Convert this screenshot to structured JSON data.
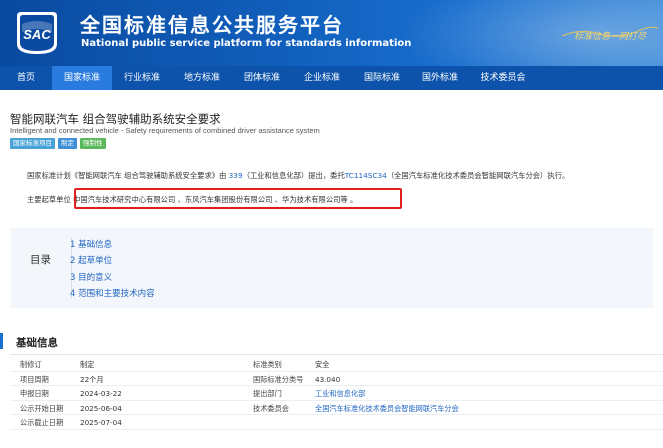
{
  "header": {
    "logo_text": "SAC",
    "title": "全国标准信息公共服务平台",
    "subtitle": "National public service platform  for standards information",
    "slogan": "标准信息一网打尽"
  },
  "nav": {
    "items": [
      {
        "label": "首页",
        "width": 52
      },
      {
        "label": "国家标准",
        "width": 60,
        "active": true
      },
      {
        "label": "行业标准",
        "width": 60
      },
      {
        "label": "地方标准",
        "width": 60
      },
      {
        "label": "团体标准",
        "width": 60
      },
      {
        "label": "企业标准",
        "width": 60
      },
      {
        "label": "国际标准",
        "width": 60
      },
      {
        "label": "国外标准",
        "width": 56
      },
      {
        "label": "技术委员会",
        "width": 70
      }
    ]
  },
  "standard": {
    "title_cn": "智能网联汽车 组合驾驶辅助系统安全要求",
    "title_en": "Intelligent and connected vehicle - Safety requirements of combined driver assistance system",
    "tags": [
      "国家标准项目",
      "制定",
      "强制性"
    ]
  },
  "description": {
    "part1": "国家标准计划《智能网联汽车 组合驾驶辅助系统安全要求》由 ",
    "dept_code": "339",
    "part2": "（工业和信息化部）提出，委托",
    "tc_code": "TC114SC34",
    "part3": "（全国汽车标准化技术委员会智能网联汽车分会）执行。",
    "drafters_label": "主要起草单位",
    "drafters": " 中国汽车技术研究中心有限公司 、东风汽车集团股份有限公司 、华为技术有限公司等 。"
  },
  "toc": {
    "label": "目录",
    "items": [
      "1  基础信息",
      "2  起草单位",
      "3  目的意义",
      "4  范围和主要技术内容"
    ]
  },
  "basic_info": {
    "section_title": "基础信息",
    "rows": [
      {
        "l1": "制修订",
        "v1": "制定",
        "l2": "标准类别",
        "v2": "安全",
        "v2_link": false
      },
      {
        "l1": "项目周期",
        "v1": "22个月",
        "l2": "国际标准分类号",
        "v2": "43.040",
        "v2_link": false
      },
      {
        "l1": "申报日期",
        "v1": "2024-03-22",
        "l2": "提出部门",
        "v2": "工业和信息化部",
        "v2_link": true
      },
      {
        "l1": "公示开始日期",
        "v1": "2025-06-04",
        "l2": "技术委员会",
        "v2": "全国汽车标准化技术委员会智能网联汽车分会",
        "v2_link": true
      },
      {
        "l1": "公示截止日期",
        "v1": "2025-07-04",
        "l2": "",
        "v2": "",
        "v2_link": false
      }
    ]
  }
}
